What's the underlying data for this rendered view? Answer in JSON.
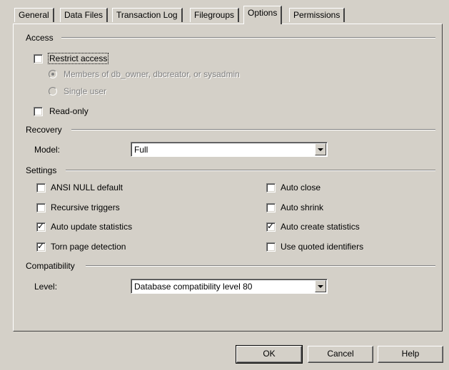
{
  "tabs": [
    {
      "label": "General"
    },
    {
      "label": "Data Files"
    },
    {
      "label": "Transaction Log"
    },
    {
      "label": "Filegroups"
    },
    {
      "label": "Options",
      "active": true
    },
    {
      "label": "Permissions"
    }
  ],
  "access": {
    "title": "Access",
    "restrict_access": {
      "label": "Restrict access",
      "checked": false
    },
    "radio_members": {
      "label": "Members of db_owner, dbcreator, or sysadmin",
      "selected": true,
      "disabled": true
    },
    "radio_single": {
      "label": "Single user",
      "selected": false,
      "disabled": true
    },
    "read_only": {
      "label": "Read-only",
      "checked": false
    }
  },
  "recovery": {
    "title": "Recovery",
    "model_label": "Model:",
    "model_value": "Full"
  },
  "settings": {
    "title": "Settings",
    "ansi_null_default": {
      "label": "ANSI NULL default",
      "checked": false
    },
    "recursive_triggers": {
      "label": "Recursive triggers",
      "checked": false
    },
    "auto_update_statistics": {
      "label": "Auto update statistics",
      "checked": true
    },
    "torn_page_detection": {
      "label": "Torn page detection",
      "checked": true
    },
    "auto_close": {
      "label": "Auto close",
      "checked": false
    },
    "auto_shrink": {
      "label": "Auto shrink",
      "checked": false
    },
    "auto_create_statistics": {
      "label": "Auto create statistics",
      "checked": true
    },
    "use_quoted_identifiers": {
      "label": "Use quoted identifiers",
      "checked": false
    }
  },
  "compatibility": {
    "title": "Compatibility",
    "level_label": "Level:",
    "level_value": "Database compatibility level 80"
  },
  "buttons": {
    "ok": "OK",
    "cancel": "Cancel",
    "help": "Help"
  }
}
